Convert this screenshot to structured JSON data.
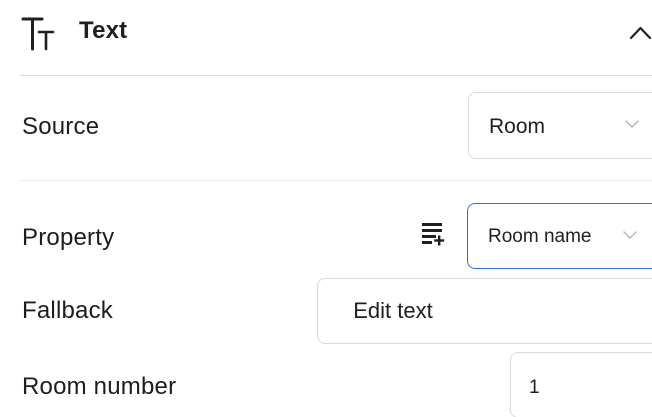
{
  "header": {
    "title": "Text",
    "icon": "text-type-icon",
    "collapse_icon": "chevron-up-icon"
  },
  "rows": {
    "source": {
      "label": "Source",
      "value": "Room"
    },
    "property": {
      "label": "Property",
      "value": "Room name",
      "add_icon": "list-add-icon"
    },
    "fallback": {
      "label": "Fallback",
      "button_label": "Edit text",
      "value": ""
    },
    "room_number": {
      "label": "Room number",
      "value": "1"
    }
  },
  "colors": {
    "focus_border": "#2f6fed",
    "divider": "#e3e3e3",
    "input_border": "#d9d9d9"
  }
}
